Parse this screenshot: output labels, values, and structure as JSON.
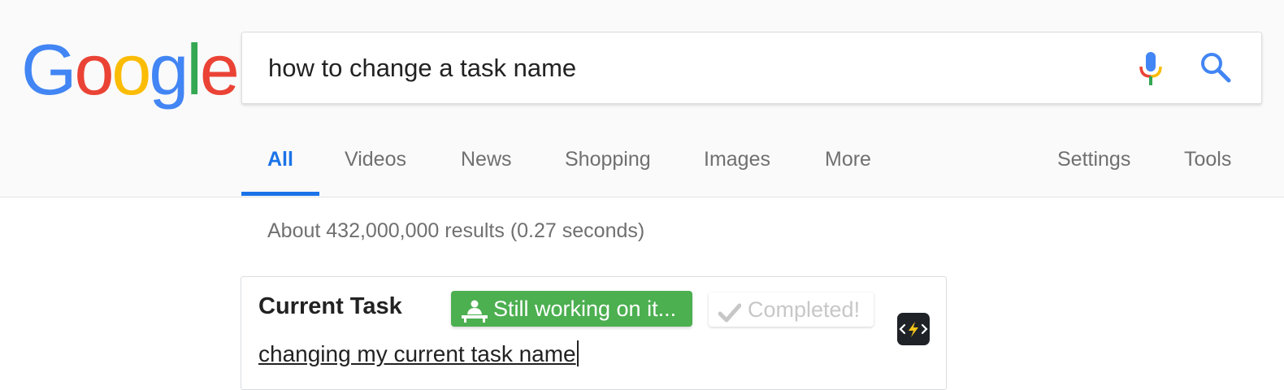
{
  "logo": {
    "letters": [
      "G",
      "o",
      "o",
      "g",
      "l",
      "e"
    ],
    "colors": [
      "#4285F4",
      "#EA4335",
      "#FBBC05",
      "#4285F4",
      "#34A853",
      "#EA4335"
    ]
  },
  "search": {
    "query": "how to change a task name",
    "mic_icon": "microphone-icon",
    "search_icon": "search-icon"
  },
  "tabs": {
    "items": [
      {
        "label": "All",
        "active": true
      },
      {
        "label": "Videos"
      },
      {
        "label": "News"
      },
      {
        "label": "Shopping"
      },
      {
        "label": "Images"
      },
      {
        "label": "More"
      }
    ],
    "settings": "Settings",
    "tools": "Tools"
  },
  "stats": "About 432,000,000 results (0.27 seconds)",
  "task_card": {
    "title": "Current Task",
    "working_label": "Still working on it...",
    "working_icon": "person-at-desk-icon",
    "completed_label": "Completed!",
    "completed_icon": "checkmark-icon",
    "task_name": "changing my current task name",
    "extension_icon": "code-lightning-icon"
  },
  "colors": {
    "accent": "#1a73e8",
    "working_green": "#4caf50",
    "muted_text": "#707070"
  }
}
